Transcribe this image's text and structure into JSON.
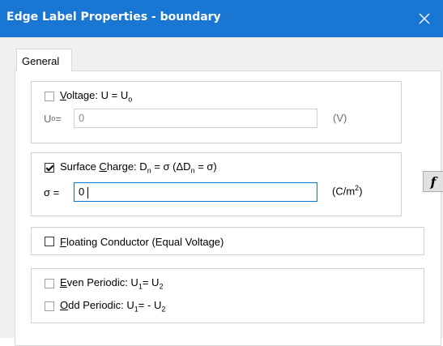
{
  "window": {
    "title": "Edge Label Properties - boundary",
    "close_icon": "close-icon"
  },
  "tabs": [
    {
      "label": "General",
      "selected": true
    }
  ],
  "voltage": {
    "checked": false,
    "enabled": true,
    "label_pre": "",
    "label_mnemonic": "V",
    "label_rest": "oltage: U = U",
    "label_sub": "o",
    "field_label": "U",
    "field_label_sub": "o",
    "field_label_eq": " =",
    "value": "0",
    "unit": "(V)"
  },
  "function_button": {
    "label": "f"
  },
  "surface_charge": {
    "checked": true,
    "label_part1": "Surface ",
    "label_mnemonic": "C",
    "label_part2": "harge: D",
    "label_sub1": "n",
    "label_part3": " = σ (ΔD",
    "label_sub2": "n",
    "label_part4": " = σ)",
    "field_label": "σ =",
    "value": "0",
    "unit_pre": "(C/m",
    "unit_sup": "2",
    "unit_post": ")"
  },
  "floating": {
    "checked": false,
    "label_mnemonic": "F",
    "label_rest": "loating Conductor (Equal Voltage)"
  },
  "even_periodic": {
    "checked": false,
    "label_mnemonic": "E",
    "label_part1": "ven Periodic: U",
    "sub1": "1",
    "label_part2": "= U",
    "sub2": "2"
  },
  "odd_periodic": {
    "checked": false,
    "label_mnemonic": "O",
    "label_part1": "dd Periodic: U",
    "sub1": "1",
    "label_part2": "= - U",
    "sub2": "2"
  }
}
